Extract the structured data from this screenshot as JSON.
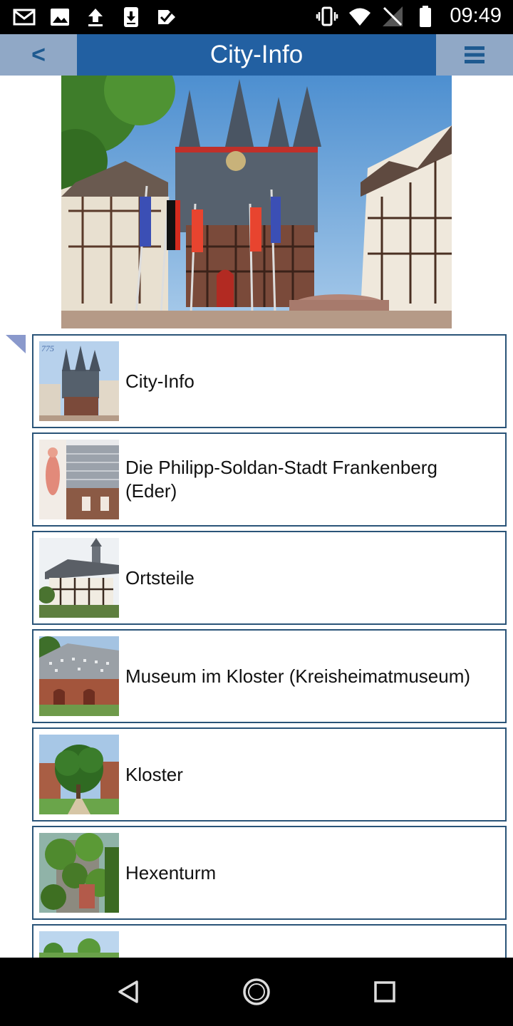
{
  "status_bar": {
    "time": "09:49",
    "left_icons": [
      "gmail-icon",
      "image-icon",
      "upload-icon",
      "download-icon",
      "check-badge-icon"
    ],
    "right_icons": [
      "vibrate-icon",
      "wifi-icon",
      "no-sim-icon",
      "battery-icon"
    ]
  },
  "header": {
    "back_label": "<",
    "title": "City-Info",
    "menu_icon": "hamburger-menu-icon",
    "colors": {
      "bar": "#2260a2",
      "side_buttons": "#90a8c6",
      "icon": "#1e5a90"
    }
  },
  "hero_image": {
    "subject": "town-hall-photo"
  },
  "list": {
    "items": [
      {
        "label": "City-Info",
        "thumb": "city-info-thumbnail"
      },
      {
        "label": "Die Philipp-Soldan-Stadt Frankenberg (Eder)",
        "thumb": "philipp-soldan-thumbnail"
      },
      {
        "label": "Ortsteile",
        "thumb": "ortsteile-thumbnail"
      },
      {
        "label": "Museum im Kloster (Kreisheimatmuseum)",
        "thumb": "museum-thumbnail"
      },
      {
        "label": "Kloster",
        "thumb": "kloster-thumbnail"
      },
      {
        "label": "Hexenturm",
        "thumb": "hexenturm-thumbnail"
      },
      {
        "label": "",
        "thumb": "next-item-thumbnail"
      }
    ],
    "border_color": "#2a5478"
  },
  "nav_bar": {
    "buttons": [
      "back-nav-icon",
      "home-nav-icon",
      "recents-nav-icon"
    ]
  }
}
